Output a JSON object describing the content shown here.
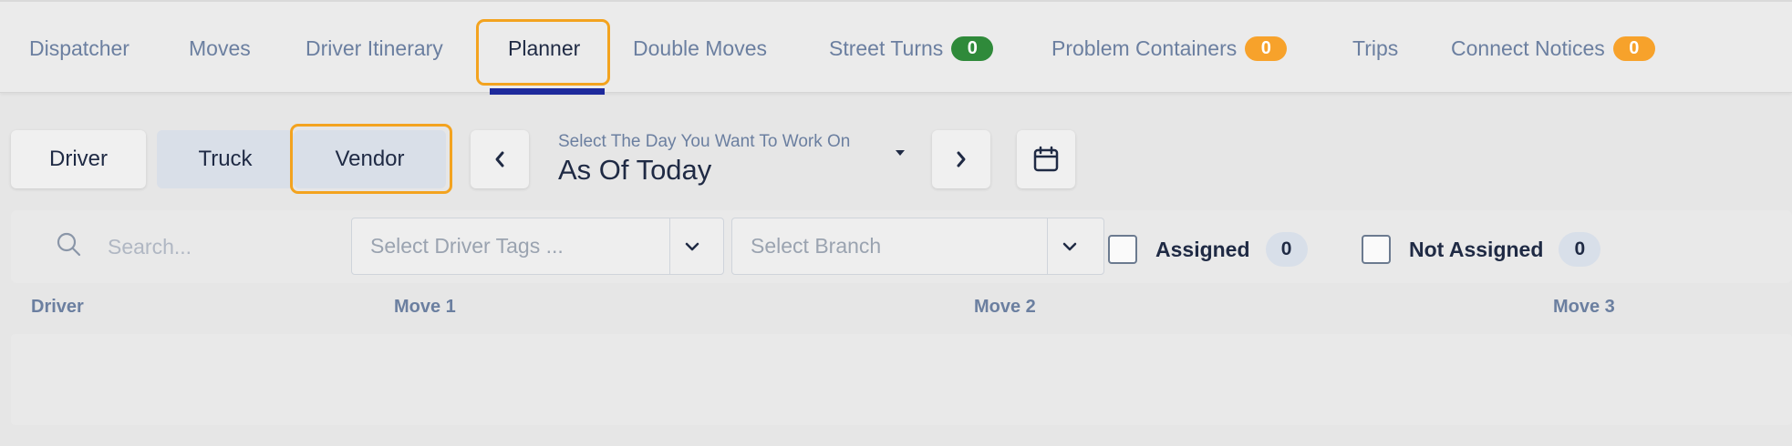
{
  "tabs": [
    {
      "label": "Dispatcher"
    },
    {
      "label": "Moves"
    },
    {
      "label": "Driver Itinerary"
    },
    {
      "label": "Planner",
      "active": true
    },
    {
      "label": "Double Moves"
    },
    {
      "label": "Street Turns",
      "badge": "0",
      "badge_color": "#2f8a3a"
    },
    {
      "label": "Problem Containers",
      "badge": "0",
      "badge_color": "#f7a22b"
    },
    {
      "label": "Trips"
    },
    {
      "label": "Connect Notices",
      "badge": "0",
      "badge_color": "#f7a22b"
    }
  ],
  "view_toggle": {
    "driver": "Driver",
    "truck": "Truck",
    "vendor": "Vendor"
  },
  "date_picker": {
    "label": "Select The Day You Want To Work On",
    "value": "As Of Today",
    "prev_icon": "chevron-left-icon",
    "next_icon": "chevron-right-icon",
    "calendar_icon": "calendar-icon"
  },
  "filters": {
    "search_placeholder": "Search...",
    "driver_tags_placeholder": "Select Driver Tags ...",
    "branch_placeholder": "Select Branch",
    "assigned_label": "Assigned",
    "assigned_count": "0",
    "not_assigned_label": "Not Assigned",
    "not_assigned_count": "0"
  },
  "columns": [
    "Driver",
    "Move 1",
    "Move 2",
    "Move 3"
  ],
  "colors": {
    "highlight": "#f3a31f",
    "active_underline": "#1e2a9c"
  }
}
